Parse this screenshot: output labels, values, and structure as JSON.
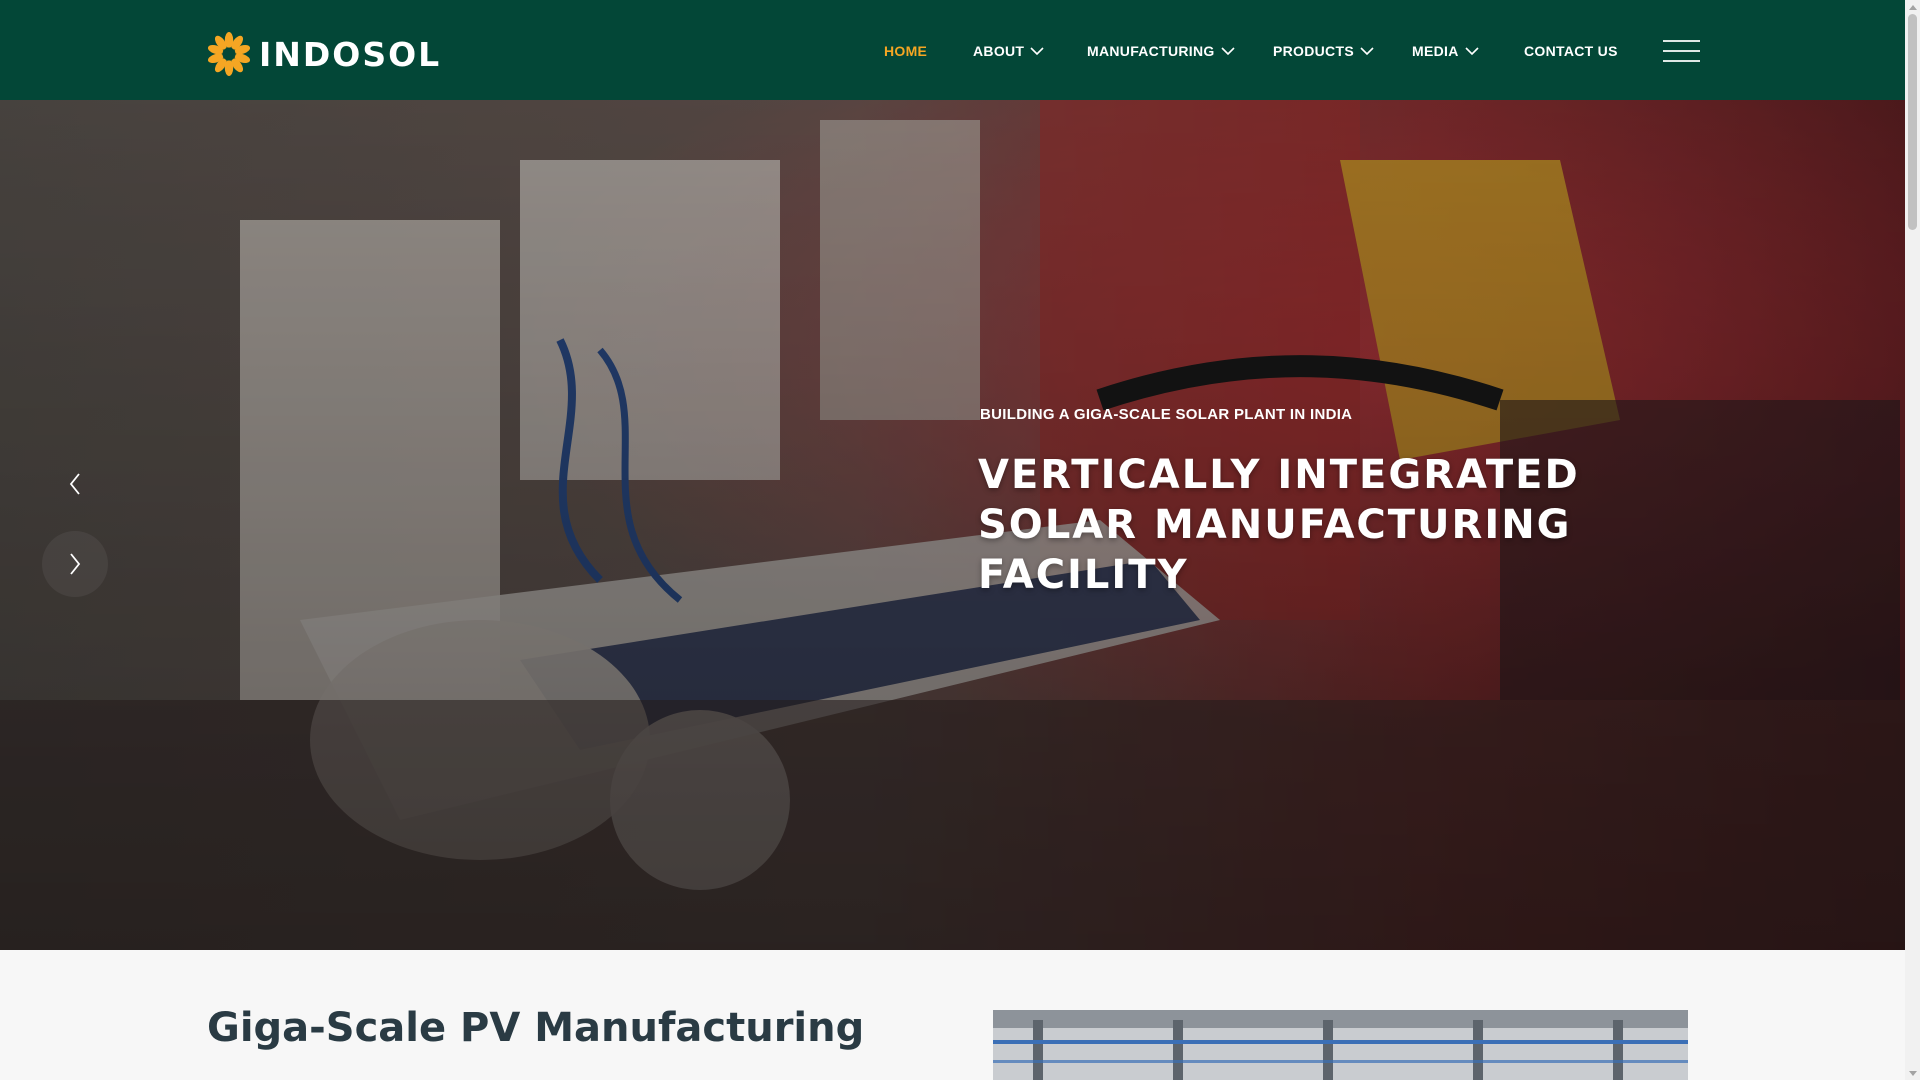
{
  "brand": {
    "name": "INDOSOL",
    "logo_icon": "sun-flower-icon",
    "accent": "#f5a623",
    "header_bg": "#034737"
  },
  "nav": {
    "items": [
      {
        "label": "HOME",
        "active": true,
        "dropdown": false
      },
      {
        "label": "ABOUT",
        "active": false,
        "dropdown": true
      },
      {
        "label": "MANUFACTURING",
        "active": false,
        "dropdown": true
      },
      {
        "label": "PRODUCTS",
        "active": false,
        "dropdown": true
      },
      {
        "label": "MEDIA",
        "active": false,
        "dropdown": true
      },
      {
        "label": "CONTACT US",
        "active": false,
        "dropdown": false
      }
    ],
    "menu_icon": "hamburger-menu-icon"
  },
  "hero": {
    "subtitle": "BUILDING A GIGA-SCALE SOLAR PLANT IN INDIA",
    "title": "VERTICALLY INTEGRATED SOLAR MANUFACTURING FACILITY",
    "prev_icon": "chevron-left-icon",
    "next_icon": "chevron-right-icon"
  },
  "section": {
    "title": "Giga-Scale PV Manufacturing"
  }
}
